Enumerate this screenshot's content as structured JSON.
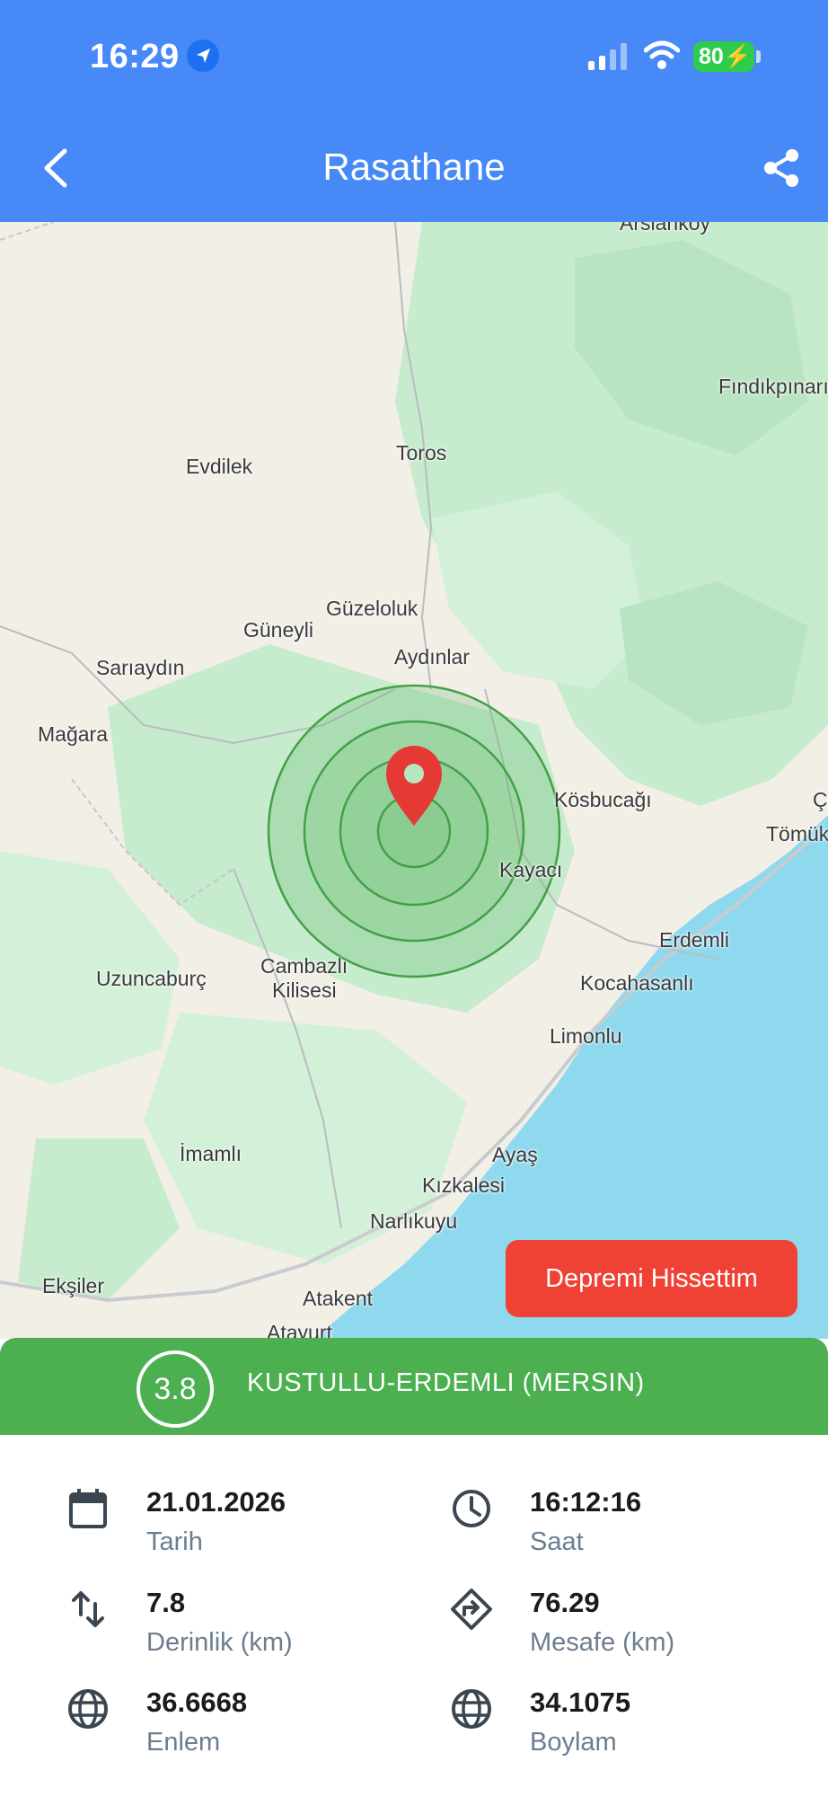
{
  "status_bar": {
    "time": "16:29",
    "battery": "80"
  },
  "header": {
    "title": "Rasathane"
  },
  "map": {
    "labels": [
      {
        "text": "Arslanköy"
      },
      {
        "text": "Fındıkpınarı"
      },
      {
        "text": "Toros"
      },
      {
        "text": "Evdilek"
      },
      {
        "text": "Güzeloluk"
      },
      {
        "text": "Güneyli"
      },
      {
        "text": "Aydınlar"
      },
      {
        "text": "Sarıaydın"
      },
      {
        "text": "Mağara"
      },
      {
        "text": "Kösbucağı"
      },
      {
        "text": "Çe"
      },
      {
        "text": "Tömük"
      },
      {
        "text": "Kayacı"
      },
      {
        "text": "Erdemli"
      },
      {
        "text": "Cambazlı"
      },
      {
        "text": "Kilisesi"
      },
      {
        "text": "Uzuncaburç"
      },
      {
        "text": "Kocahasanlı"
      },
      {
        "text": "Limonlu"
      },
      {
        "text": "İmamlı"
      },
      {
        "text": "Ayaş"
      },
      {
        "text": "Kızkalesi"
      },
      {
        "text": "Narlıkuyu"
      },
      {
        "text": "Ekşiler"
      },
      {
        "text": "Atakent"
      },
      {
        "text": "Atayurt"
      }
    ]
  },
  "feel_button": "Depremi Hissettim",
  "quake": {
    "magnitude": "3.8",
    "location": "KUSTULLU-ERDEMLI (MERSIN)"
  },
  "details": {
    "date": {
      "value": "21.01.2026",
      "label": "Tarih"
    },
    "time": {
      "value": "16:12:16",
      "label": "Saat"
    },
    "depth": {
      "value": "7.8",
      "label": "Derinlik (km)"
    },
    "distance": {
      "value": "76.29",
      "label": "Mesafe (km)"
    },
    "latitude": {
      "value": "36.6668",
      "label": "Enlem"
    },
    "longitude": {
      "value": "34.1075",
      "label": "Boylam"
    }
  },
  "colors": {
    "header": "#4689f7",
    "band": "#4caf50",
    "feel_button": "#f04234",
    "sea": "#8fd9ef",
    "land": "#f2efe6",
    "forest": "#c6ebcd"
  }
}
